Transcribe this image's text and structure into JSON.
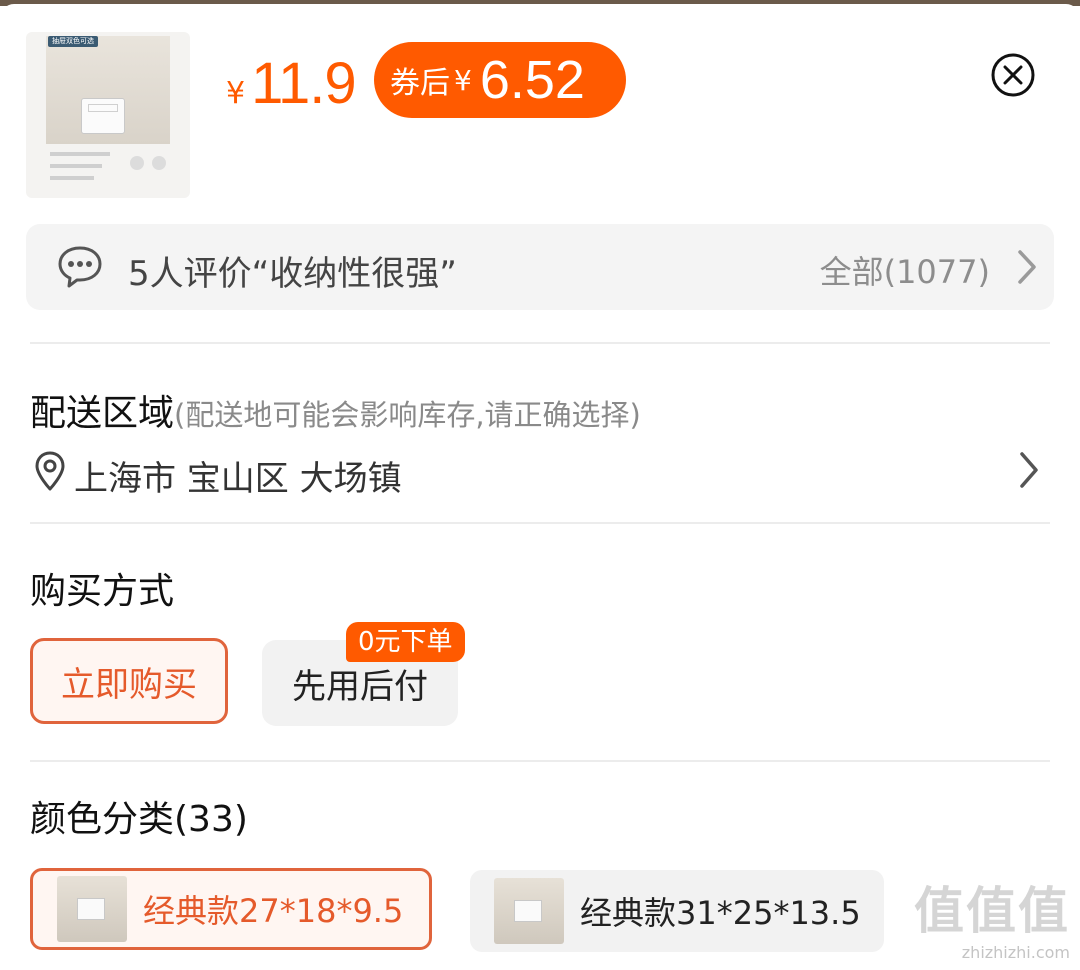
{
  "product": {
    "thumb_tag": "抽屉双色可选",
    "price_symbol": "¥",
    "price": "11.9",
    "coupon_label": "券后",
    "coupon_symbol": "¥",
    "coupon_price": "6.52"
  },
  "review": {
    "text": "5人评价“收纳性很强”",
    "all_label": "全部(1077)"
  },
  "delivery": {
    "title": "配送区域",
    "note": "(配送地可能会影响库存,请正确选择)",
    "location": "上海市 宝山区 大场镇"
  },
  "purchase": {
    "title": "购买方式",
    "options": [
      {
        "label": "立即购买",
        "selected": true
      },
      {
        "label": "先用后付",
        "selected": false,
        "badge": "0元下单"
      }
    ]
  },
  "colors": {
    "title": "颜色分类(33)",
    "options": [
      {
        "label": "经典款27*18*9.5",
        "selected": true
      },
      {
        "label": "经典款31*25*13.5",
        "selected": false
      }
    ]
  },
  "watermark": {
    "big": "值值值",
    "small": "zhizhizhi.com"
  },
  "theme": {
    "accent": "#ff5a00",
    "selected_border": "#e0643c"
  }
}
